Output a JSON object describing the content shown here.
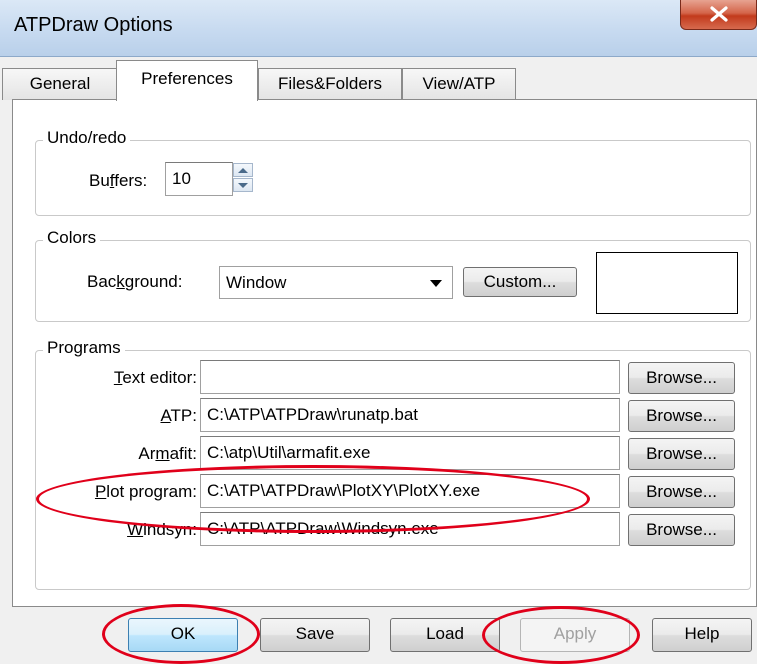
{
  "window": {
    "title": "ATPDraw Options"
  },
  "tabs": [
    {
      "label": "General"
    },
    {
      "label": "Preferences"
    },
    {
      "label": "Files&Folders"
    },
    {
      "label": "View/ATP"
    }
  ],
  "undo": {
    "legend": "Undo/redo",
    "buffers_label_a": "Bu",
    "buffers_label_u": "f",
    "buffers_label_b": "fers:",
    "buffers_value": "10"
  },
  "colors": {
    "legend": "Colors",
    "bg_label_a": "Bac",
    "bg_label_u": "k",
    "bg_label_b": "ground:",
    "bg_value": "Window",
    "custom_label": "Custom...",
    "swatch_color": "#ffffff"
  },
  "programs": {
    "legend": "Programs",
    "browse_label": "Browse...",
    "rows": [
      {
        "label_a": "",
        "label_u": "T",
        "label_b": "ext editor:",
        "value": ""
      },
      {
        "label_a": "",
        "label_u": "A",
        "label_b": "TP:",
        "value": "C:\\ATP\\ATPDraw\\runatp.bat"
      },
      {
        "label_a": "Ar",
        "label_u": "m",
        "label_b": "afit:",
        "value": "C:\\atp\\Util\\armafit.exe"
      },
      {
        "label_a": "",
        "label_u": "P",
        "label_b": "lot program:",
        "value": "C:\\ATP\\ATPDraw\\PlotXY\\PlotXY.exe"
      },
      {
        "label_a": "",
        "label_u": "W",
        "label_b": "indsyn:",
        "value": "C:\\ATP\\ATPDraw\\Windsyn.exe"
      }
    ]
  },
  "buttons": {
    "ok": "OK",
    "save": "Save",
    "load": "Load",
    "apply": "Apply",
    "help": "Help"
  },
  "accent": {
    "annotation": "#e0001a"
  }
}
